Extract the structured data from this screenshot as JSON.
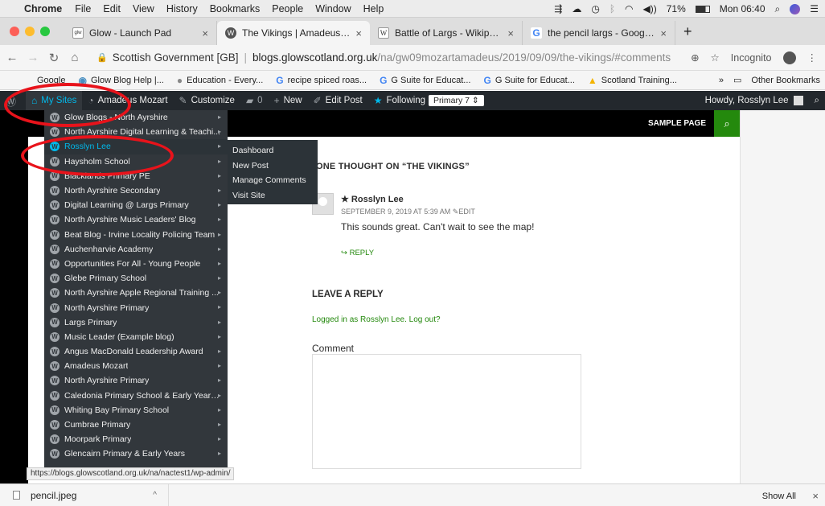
{
  "mac_menubar": {
    "app_name": "Chrome",
    "menus": [
      "File",
      "Edit",
      "View",
      "History",
      "Bookmarks",
      "People",
      "Window",
      "Help"
    ],
    "battery": "71%",
    "clock": "Mon 06:40"
  },
  "tabs": [
    {
      "title": "Glow - Launch Pad",
      "favicon": "glow",
      "active": false
    },
    {
      "title": "The Vikings | Amadeus Mozart",
      "favicon": "wp",
      "active": true
    },
    {
      "title": "Battle of Largs - Wikipedia",
      "favicon": "W",
      "active": false
    },
    {
      "title": "the pencil largs - Google Searc",
      "favicon": "G",
      "active": false
    }
  ],
  "address_bar": {
    "org": "Scottish Government [GB]",
    "url_host": "blogs.glowscotland.org.uk",
    "url_path": "/na/gw09mozartamadeus/2019/09/09/the-vikings/#comments",
    "profile": "Incognito"
  },
  "bookmarks": {
    "items": [
      "Google",
      "Glow Blog Help |...",
      "Education - Every...",
      "recipe spiced roas...",
      "G Suite for Educat...",
      "G Suite for Educat...",
      "Scotland Training..."
    ],
    "other": "Other Bookmarks"
  },
  "admin_bar": {
    "my_sites": "My Sites",
    "site_name": "Amadeus Mozart",
    "customize": "Customize",
    "comments_count": "0",
    "new": "New",
    "edit_post": "Edit Post",
    "following": "Following",
    "primary_select": "Primary 7",
    "howdy": "Howdy, Rosslyn Lee"
  },
  "site_header": {
    "sample_page": "SAMPLE PAGE"
  },
  "my_sites_menu": [
    "Glow Blogs - North Ayrshire",
    "North Ayrshire Digital Learning & Teachi...",
    "Rosslyn Lee",
    "Haysholm School",
    "Blacklands Primary PE",
    "North Ayrshire Secondary",
    "Digital Learning @ Largs Primary",
    "North Ayrshire Music Leaders' Blog",
    "Beat Blog - Irvine Locality Policing Team",
    "Auchenharvie Academy",
    "Opportunities For All - Young People",
    "Glebe Primary School",
    "North Ayrshire Apple Regional Training ...",
    "North Ayrshire Primary",
    "Largs Primary",
    "Music Leader (Example blog)",
    "Angus MacDonald Leadership Award",
    "Amadeus Mozart",
    "North Ayrshire Primary",
    "Caledonia Primary School & Early Years ...",
    "Whiting Bay Primary School",
    "Cumbrae Primary",
    "Moorpark Primary",
    "Glencairn Primary & Early Years"
  ],
  "submenu": [
    "Dashboard",
    "New Post",
    "Manage Comments",
    "Visit Site"
  ],
  "comments": {
    "title": "ONE THOUGHT ON “THE VIKINGS”",
    "author": "Rosslyn Lee",
    "date": "SEPTEMBER 9, 2019 AT 5:39 AM",
    "edit": "EDIT",
    "text": "This sounds great. Can't wait to see the map!",
    "reply": "REPLY"
  },
  "reply_form": {
    "heading": "LEAVE A REPLY",
    "logged_in": "Logged in as Rosslyn Lee. Log out?",
    "comment_label": "Comment"
  },
  "status_url": "https://blogs.glowscotland.org.uk/na/nactest1/wp-admin/",
  "downloads": {
    "file": "pencil.jpeg",
    "show_all": "Show All"
  },
  "colors": {
    "wp_admin_bg": "#23282d",
    "wp_highlight": "#00b9eb",
    "theme_green": "#24890d",
    "annotation_red": "#e8131b"
  }
}
